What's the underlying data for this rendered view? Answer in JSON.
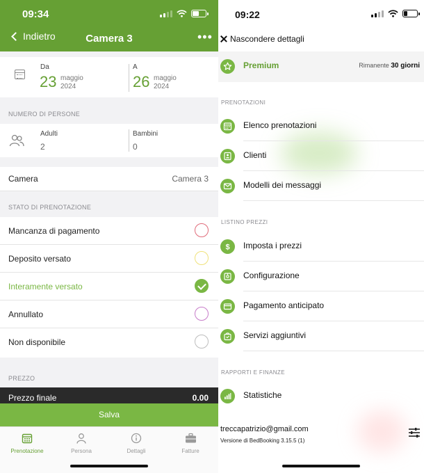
{
  "left": {
    "status_time": "09:34",
    "back_label": "Indietro",
    "title": "Camera 3",
    "more": "•••",
    "dates": {
      "from_label": "Da",
      "from_day": "23",
      "from_month": "maggio",
      "from_year": "2024",
      "to_label": "A",
      "to_day": "26",
      "to_month": "maggio",
      "to_year": "2024"
    },
    "people_section": "NUMERO DI PERSONE",
    "adults_label": "Adulti",
    "adults_value": "2",
    "children_label": "Bambini",
    "children_value": "0",
    "camera_label": "Camera",
    "camera_value": "Camera 3",
    "status_section": "STATO DI PRENOTAZIONE",
    "statuses": [
      {
        "label": "Mancanza di pagamento",
        "color": "#e06b7a",
        "checked": false
      },
      {
        "label": "Deposito versato",
        "color": "#f0e27a",
        "checked": false
      },
      {
        "label": "Interamente versato",
        "color": "#7ab744",
        "checked": true
      },
      {
        "label": "Annullato",
        "color": "#c77cc9",
        "checked": false
      },
      {
        "label": "Non disponibile",
        "color": "#bdbdbd",
        "checked": false
      }
    ],
    "price_section": "PREZZO",
    "price_label": "Prezzo finale",
    "price_value": "0.00",
    "save_label": "Salva",
    "tabs": [
      {
        "label": "Prenotazione",
        "icon": "calendar-icon",
        "active": true
      },
      {
        "label": "Persona",
        "icon": "person-icon",
        "active": false
      },
      {
        "label": "Dettagli",
        "icon": "info-icon",
        "active": false
      },
      {
        "label": "Fatture",
        "icon": "briefcase-icon",
        "active": false
      }
    ]
  },
  "right": {
    "status_time": "09:22",
    "hide_label": "Nascondere dettagli",
    "premium_label": "Premium",
    "remaining_label": "Rimanente",
    "remaining_value": "30 giorni",
    "sections": {
      "bookings": "PRENOTAZIONI",
      "prices": "LISTINO PREZZI",
      "reports": "RAPPORTI E FINANZE"
    },
    "booking_items": [
      "Elenco prenotazioni",
      "Clienti",
      "Modelli dei messaggi"
    ],
    "price_items": [
      "Imposta i prezzi",
      "Configurazione",
      "Pagamento anticipato",
      "Servizi aggiuntivi"
    ],
    "report_items": [
      "Statistiche"
    ],
    "email": "treccapatrizio@gmail.com",
    "version": "Versione di BedBooking 3.15.5 (1)"
  },
  "colors": {
    "brand_green": "#66a034",
    "accent_green": "#7ab744",
    "price_bar": "#2a2a2a"
  }
}
